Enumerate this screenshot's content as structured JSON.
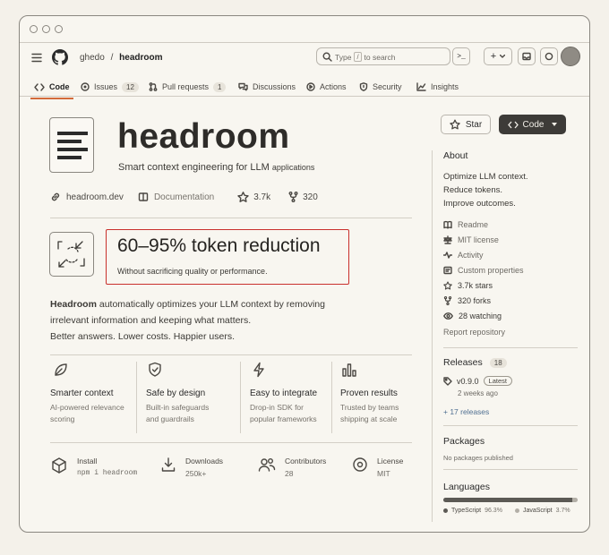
{
  "nav": {
    "owner": "ghedo",
    "separator": "/",
    "repo": "headroom",
    "search_prefix": "Type",
    "search_key": "/",
    "search_suffix": "to search",
    "terminal_glyph": ">_",
    "plus_glyph": "+"
  },
  "tabs": [
    {
      "label": "Code"
    },
    {
      "label": "Issues",
      "count": "12"
    },
    {
      "label": "Pull requests",
      "count": "1"
    },
    {
      "label": "Discussions"
    },
    {
      "label": "Actions"
    },
    {
      "label": "Security"
    },
    {
      "label": "Insights"
    }
  ],
  "hero": {
    "title": "headroom",
    "tagline_main": "Smart context engineering for LLM",
    "tagline_small": "applications",
    "website": "headroom.dev",
    "docs": "Documentation",
    "stars": "3.7k",
    "forks": "320"
  },
  "highlight": {
    "headline": "60–95%  token reduction",
    "sub": "Without sacrificing quality or performance."
  },
  "description": {
    "line1_bold": "Headroom",
    "line1_rest": " automatically optimizes your LLM context by removing",
    "line2": "irrelevant information and keeping what matters.",
    "line3": "Better answers. Lower costs. Happier users."
  },
  "features": [
    {
      "title": "Smarter context",
      "desc1": "AI-powered relevance",
      "desc2": "scoring"
    },
    {
      "title": "Safe by design",
      "desc1": "Built-in safeguards",
      "desc2": "and guardrails"
    },
    {
      "title": "Easy to integrate",
      "desc1": "Drop-in SDK for",
      "desc2": "popular frameworks"
    },
    {
      "title": "Proven results",
      "desc1": "Trusted by teams",
      "desc2": "shipping at scale"
    }
  ],
  "stats": [
    {
      "label": "Install",
      "value": "npm i headroom"
    },
    {
      "label": "Downloads",
      "value": "250k+"
    },
    {
      "label": "Contributors",
      "value": "28"
    },
    {
      "label": "License",
      "value": "MIT"
    }
  ],
  "buttons": {
    "star": "Star",
    "code": "Code"
  },
  "sidebar": {
    "about_title": "About",
    "about_lines": [
      "Optimize LLM context.",
      "Reduce tokens.",
      "Improve outcomes."
    ],
    "items": [
      "Readme",
      "MIT license",
      "Activity",
      "Custom properties",
      "3.7k stars",
      "320 forks",
      "28 watching"
    ],
    "report": "Report repository",
    "releases_title": "Releases",
    "releases_count": "18",
    "release_version": "v0.9.0",
    "release_badge": "Latest",
    "release_age": "2 weeks ago",
    "more_releases": "+ 17 releases",
    "packages_title": "Packages",
    "packages_empty": "No packages published",
    "languages_title": "Languages",
    "languages": [
      {
        "name": "TypeScript",
        "pct": "96.3%",
        "share": 0.963,
        "color": "#5c5a55"
      },
      {
        "name": "JavaScript",
        "pct": "3.7%",
        "share": 0.037,
        "color": "#b3afa7"
      }
    ]
  }
}
